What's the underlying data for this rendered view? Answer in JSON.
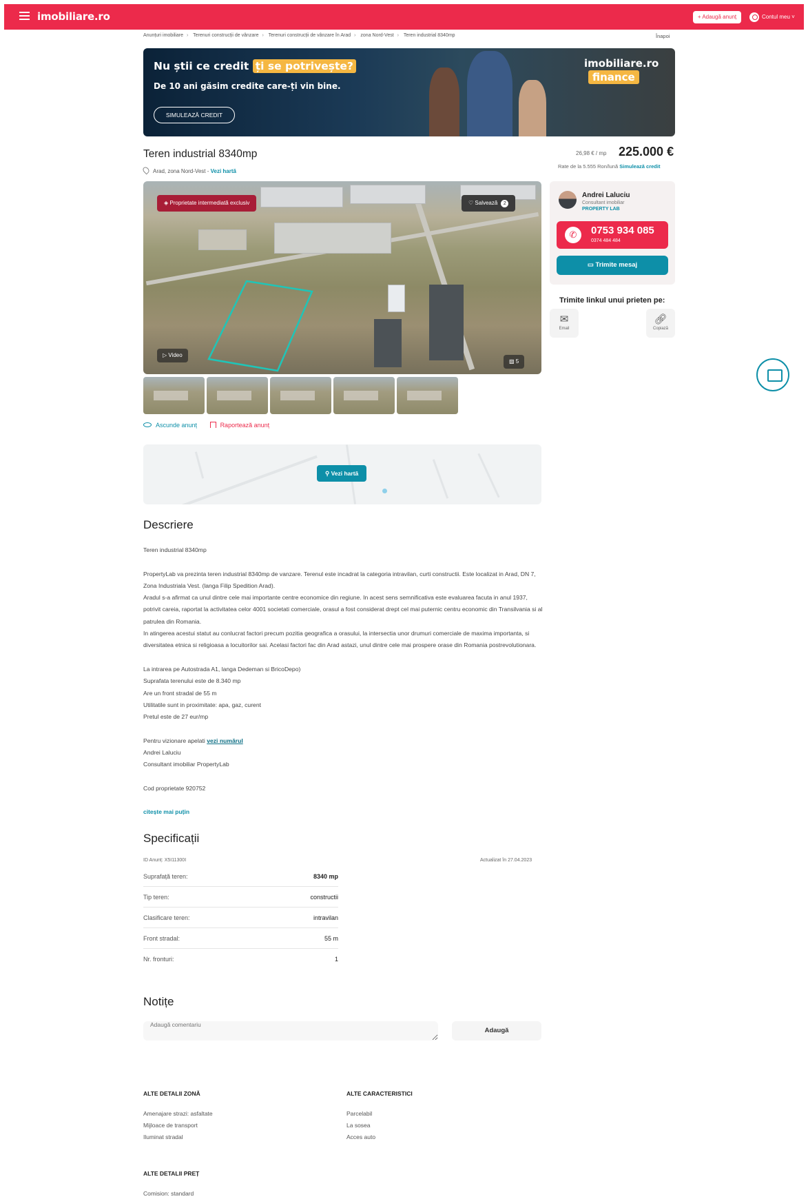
{
  "header": {
    "logo": "imobiliare.ro",
    "add_label": "+ Adaugă anunț",
    "account_label": "Contul meu ˅"
  },
  "breadcrumb": {
    "items": [
      "Anunțuri imobiliare",
      "Terenuri construcții de vânzare",
      "Terenuri construcții de vânzare în Arad",
      "zona Nord-Vest",
      "Teren industrial 8340mp"
    ],
    "back": "Înapoi"
  },
  "banner": {
    "line1_a": "Nu știi ce credit",
    "line1_hl": "ți se potrivește?",
    "line2": "De 10 ani găsim credite care-ți vin bine.",
    "cta": "SIMULEAZĂ CREDIT",
    "brand": "imobiliare.ro",
    "brand_sub": "finance"
  },
  "listing": {
    "title": "Teren industrial 8340mp",
    "location": "Arad, zona Nord-Vest",
    "map_link": "Vezi hartă",
    "price_per_m2": "26,98 € / mp",
    "price": "225.000 €",
    "rate_prefix": "Rate de la 5.555 Ron/lună",
    "rate_link": "Simulează credit"
  },
  "gallery": {
    "badge": "Proprietate intermediată exclusiv",
    "save": "Salvează",
    "save_count": "2",
    "video": "Video",
    "photo_count": "5",
    "thumbnail_count": 5
  },
  "actions": {
    "hide": "Ascunde anunț",
    "report": "Raportează anunț"
  },
  "map": {
    "button": "Vezi hartă"
  },
  "agent": {
    "name": "Andrei Laluciu",
    "role": "Consultant imobiliar",
    "company": "PROPERTY LAB",
    "phone": "0753 934 085",
    "phone2": "0374 484 484",
    "message": "Trimite mesaj",
    "share_title": "Trimite linkul unui prieten pe:",
    "share_email": "Email",
    "share_copy": "Copiază"
  },
  "description": {
    "heading": "Descriere",
    "p1": "Teren industrial 8340mp",
    "p2": "PropertyLab va prezinta teren industrial 8340mp de vanzare. Terenul este incadrat la categoria intravilan, curti constructii. Este localizat in Arad, DN 7, Zona Industriala Vest. (langa Filip Spedition Arad).",
    "p3": "Aradul s-a afirmat ca unul dintre cele mai importante centre economice din regiune. In acest sens semnificativa este evaluarea facuta in anul 1937, potrivit careia, raportat la activitatea celor 4001 societati comerciale, orasul a fost considerat drept cel mai puternic centru economic din Transilvania si al patrulea din Romania.",
    "p4": "In atingerea acestui statut au conlucrat factori precum pozitia geografica a orasului, la intersectia unor drumuri comerciale de maxima importanta, si diversitatea etnica si religioasa a locuitorilor sai. Acelasi factori fac din Arad astazi, unul dintre cele mai prospere orase din Romania postrevolutionara.",
    "list": [
      "La intrarea pe Autostrada A1, langa Dedeman si BricoDepo)",
      "Suprafata terenului este de 8.340 mp",
      "Are un front stradal de 55 m",
      "Utilitatile sunt in proximitate: apa, gaz, curent",
      "Pretul este de 27 eur/mp"
    ],
    "contact_prefix": "Pentru vizionare apelati",
    "contact_link": "vezi numărul",
    "contact_name": "Andrei Laluciu",
    "contact_role": "Consultant imobiliar PropertyLab",
    "code": "Cod proprietate 920752",
    "read_less": "citește mai puțin"
  },
  "specs": {
    "heading": "Specificații",
    "id": "ID Anunț: X5I11300I",
    "updated": "Actualizat în 27.04.2023",
    "rows": [
      {
        "k": "Suprafață teren:",
        "v": "8340 mp"
      },
      {
        "k": "Tip teren:",
        "v": "constructii"
      },
      {
        "k": "Clasificare teren:",
        "v": "intravilan"
      },
      {
        "k": "Front stradal:",
        "v": "55 m"
      },
      {
        "k": "Nr. fronturi:",
        "v": "1"
      }
    ]
  },
  "notes": {
    "heading": "Notițe",
    "placeholder": "Adaugă comentariu",
    "button": "Adaugă"
  },
  "details": {
    "zone_heading": "ALTE DETALII ZONĂ",
    "zone_items": [
      "Amenajare strazi: asfaltate",
      "Mijloace de transport",
      "Iluminat stradal"
    ],
    "char_heading": "ALTE CARACTERISTICI",
    "char_items": [
      "Parcelabil",
      "La sosea",
      "Acces auto"
    ],
    "price_heading": "ALTE DETALII PREȚ",
    "price_items": [
      "Comision: standard"
    ]
  },
  "colors": {
    "brand": "#ec2a4b",
    "accent": "#0d8fa8"
  }
}
